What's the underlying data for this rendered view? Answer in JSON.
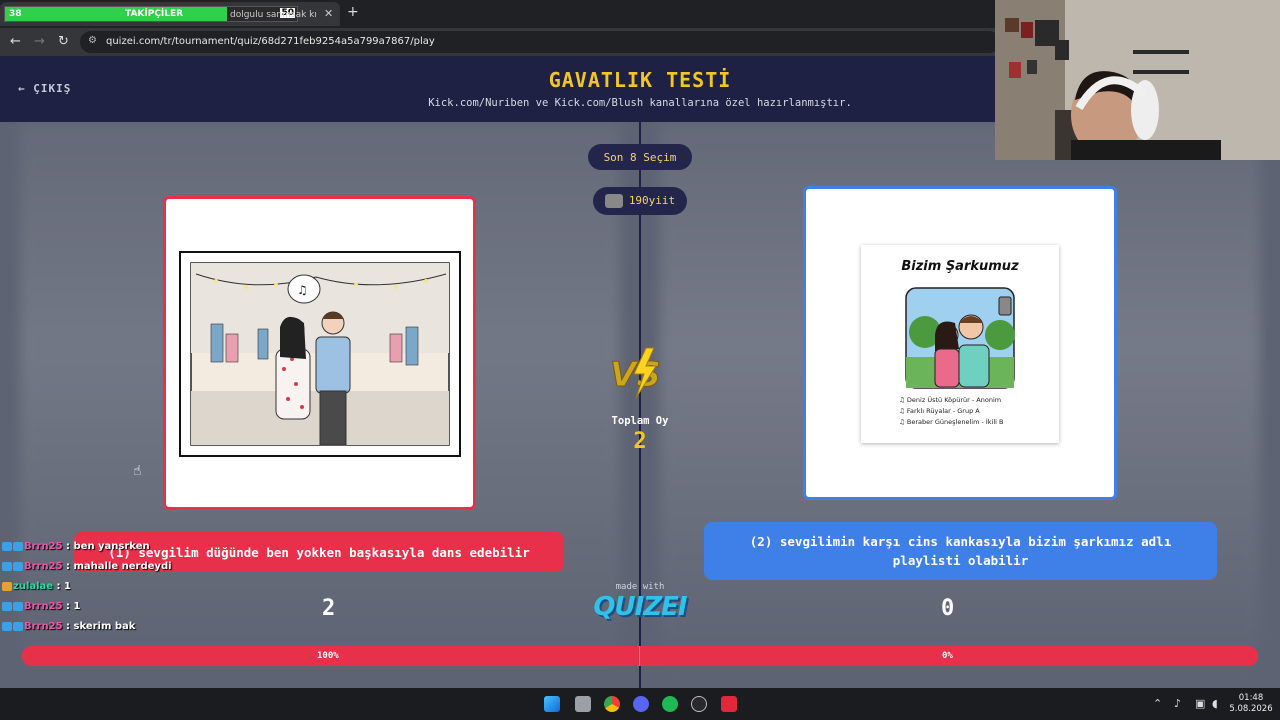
{
  "browser": {
    "follower_widget": {
      "left_count": "38",
      "label": "TAKİPÇİLER",
      "right_count": "50",
      "fill_fraction": 0.76
    },
    "tab_title": "dolgulu sanmsak kme",
    "url": "quizei.com/tr/tournament/quiz/68d271feb9254a5a799a7867/play"
  },
  "header": {
    "exit_label": "ÇIKIŞ",
    "title": "GAVATLIK TESTİ",
    "subtitle": "Kick.com/Nuriben ve Kick.com/Blush kanallarına özel hazırlanmıştır."
  },
  "round": {
    "stage_label": "Son 8 Seçim",
    "voter_name": "190yiit",
    "vs_label": "VS",
    "total_label": "Toplam Oy",
    "total_votes": "2"
  },
  "left_option": {
    "text": "(1) sevgilim düğünde ben yokken başkasıyla dans edebilir",
    "votes": "2",
    "percent_label": "100%",
    "percent": 100
  },
  "right_option": {
    "text": "(2) sevgilimin karşı cins kankasıyla bizim şarkımız adlı playlisti olabilir",
    "votes": "0",
    "percent_label": "0%",
    "percent": 0,
    "image": {
      "title": "Bizim Şarkumuz",
      "tracks": [
        "Deniz Üstü Köpürür - Anonim",
        "Farklı Rüyalar - Grup A",
        "Beraber Güneşlenelim - İkili B"
      ]
    }
  },
  "branding": {
    "made_with": "made with",
    "logo": "QUIZEI"
  },
  "chat": [
    {
      "user": "Brrn25",
      "message": "ben yansrken",
      "color": "#e35aa8"
    },
    {
      "user": "Brrn25",
      "message": "mahalle nerdeydi",
      "color": "#e35aa8"
    },
    {
      "user": "zulalae",
      "message": "1",
      "color": "#3ed6a5"
    },
    {
      "user": "Brrn25",
      "message": "1",
      "color": "#e35aa8"
    },
    {
      "user": "Brrn25",
      "message": "skerim bak",
      "color": "#e35aa8"
    }
  ],
  "taskbar": {
    "time": "01:48",
    "date": "5.08.2026"
  },
  "colors": {
    "red": "#e8304a",
    "blue": "#3f7fe8",
    "gold": "#f3c623",
    "header": "#1e2143"
  }
}
